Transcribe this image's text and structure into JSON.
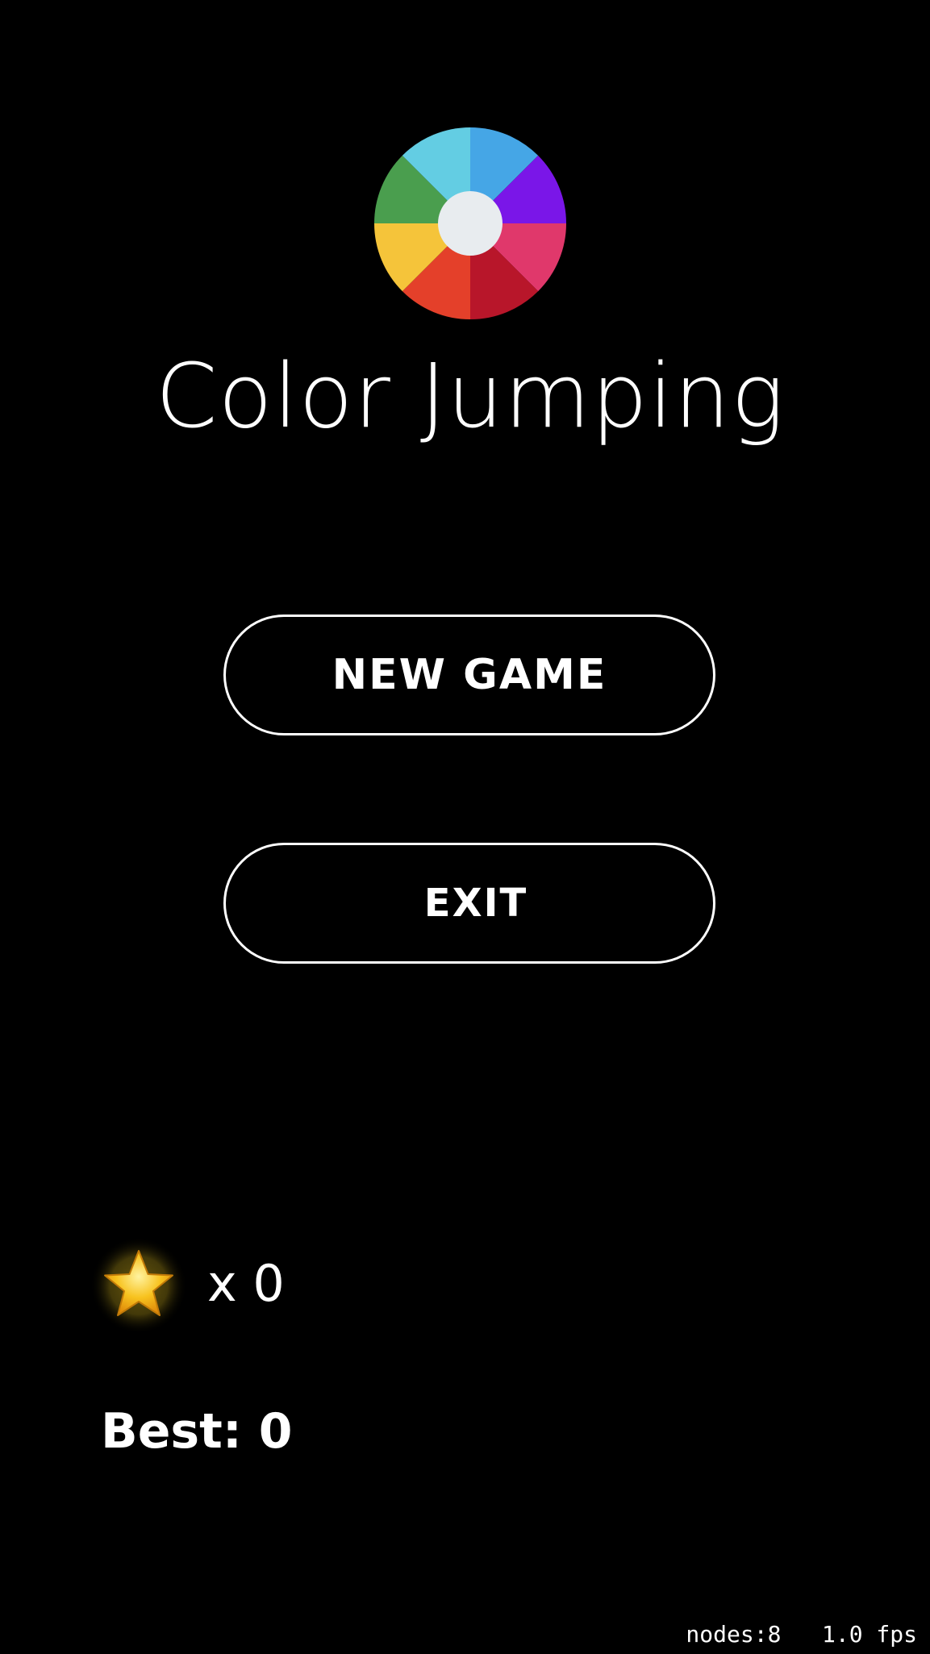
{
  "app": {
    "title": "Color Jumping"
  },
  "logo": {
    "icon": "color-wheel-icon",
    "segment_colors": [
      "#45a6e6",
      "#7a16e8",
      "#e0386b",
      "#b8162a",
      "#e4402a",
      "#f5c43a",
      "#4a9e4e",
      "#63cde3"
    ],
    "center_color": "#e8ecef"
  },
  "menu": {
    "new_game_label": "NEW GAME",
    "exit_label": "EXIT"
  },
  "stats": {
    "coin_icon": "star-icon",
    "coin_count": "x 0",
    "best": "Best: 0"
  },
  "debug": {
    "text": "nodes:8   1.0 fps"
  },
  "colors": {
    "background": "#000000",
    "foreground": "#ffffff",
    "star": "#f7c21e"
  }
}
